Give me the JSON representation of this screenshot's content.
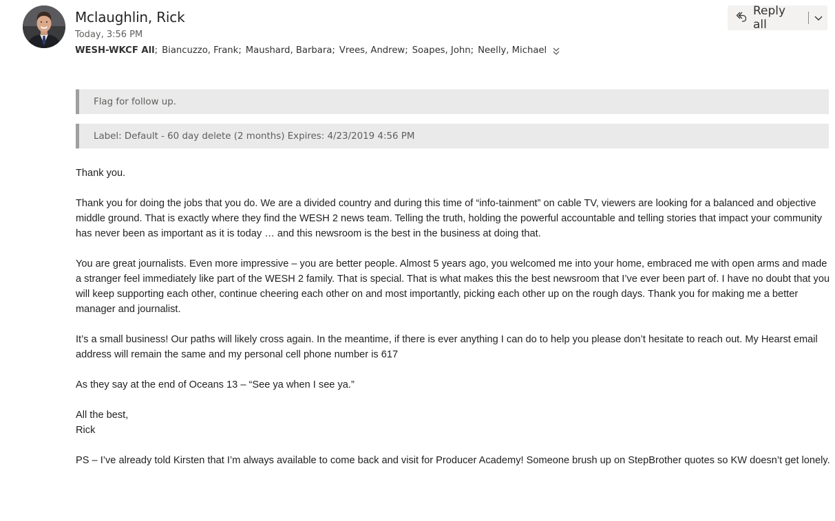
{
  "header": {
    "sender": "Mclaughlin, Rick",
    "date": "Today, 3:56 PM",
    "recipients": [
      "WESH-WKCF All",
      "Biancuzzo, Frank",
      "Maushard, Barbara",
      "Vrees, Andrew",
      "Soapes, John",
      "Neelly, Michael"
    ],
    "reply_label": "Reply all"
  },
  "infobars": {
    "flag": "Flag for follow up.",
    "label": "Label: Default - 60 day delete (2 months) Expires: 4/23/2019 4:56 PM"
  },
  "body": {
    "p1": "Thank you.",
    "p2": "Thank you for doing the jobs that you do.  We are a divided country and during this time of “info-tainment” on cable TV, viewers are looking for a balanced and objective middle ground.  That is exactly where they find the WESH 2 news team.  Telling the truth, holding the powerful accountable and telling stories that impact your community has never been as important as it is today … and this newsroom is the best in the business at doing that.",
    "p3": "You are great journalists.  Even more impressive – you are better people.  Almost 5 years ago, you welcomed me into your home, embraced me with open arms and made a stranger feel immediately like part of the WESH 2 family.  That is special.  That is what makes this the best newsroom that I’ve ever been part of.  I have no doubt that you will keep supporting each other, continue cheering each other on and most importantly, picking each other up on the rough days.  Thank you for making me a better manager and journalist.",
    "p4": "It’s a small business!  Our paths will likely cross again.  In the meantime, if there is ever anything I can do to help you please don’t hesitate to reach out.  My Hearst email address will remain the same and my personal cell phone number is 617",
    "p5": "As they say at the end of Oceans 13 – “See ya when I see ya.”",
    "p6a": "All the best,",
    "p6b": "Rick",
    "p7": "PS – I’ve already told Kirsten that I’m always available to come back and visit for Producer Academy!  Someone brush up on StepBrother quotes so KW doesn’t get lonely."
  },
  "icons": {
    "reply_all": "reply-all-icon",
    "chevron": "chevron-down-icon",
    "expand": "expand-recipients-icon"
  }
}
